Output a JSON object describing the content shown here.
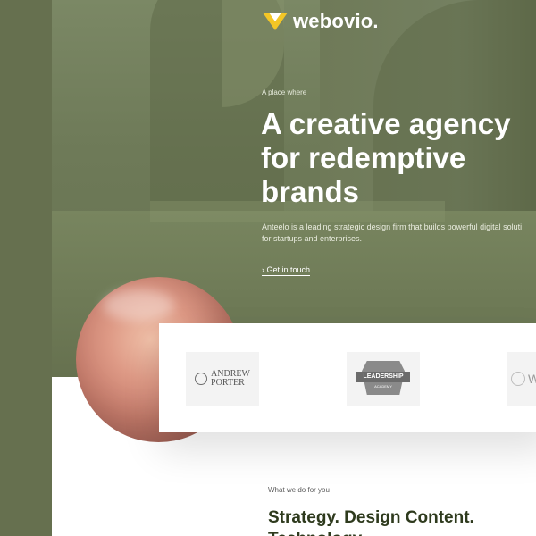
{
  "brand": {
    "name": "webovio.",
    "accent_color": "#f3c626"
  },
  "hero": {
    "eyebrow": "A place where",
    "headline": "A creative agency for redemptive brands",
    "description_line1": "Anteelo is a leading strategic design firm that builds powerful digital soluti",
    "description_line2": "for startups and enterprises.",
    "cta": "› Get in touch"
  },
  "partners": [
    {
      "name_line1": "ANDREW",
      "name_line2": "PORTER",
      "icon": "circle-button-icon"
    },
    {
      "name": "LEADERSHIP",
      "sub": "ACADEMY",
      "icon": "badge-icon"
    },
    {
      "name": "W",
      "icon": "globe-icon"
    }
  ],
  "services": {
    "eyebrow": "What we do for you",
    "title_line1": "Strategy. Design Content.",
    "title_line2": "Technology"
  },
  "colors": {
    "olive": "#66714f",
    "dark_green": "#2e3a1d",
    "white": "#ffffff"
  }
}
